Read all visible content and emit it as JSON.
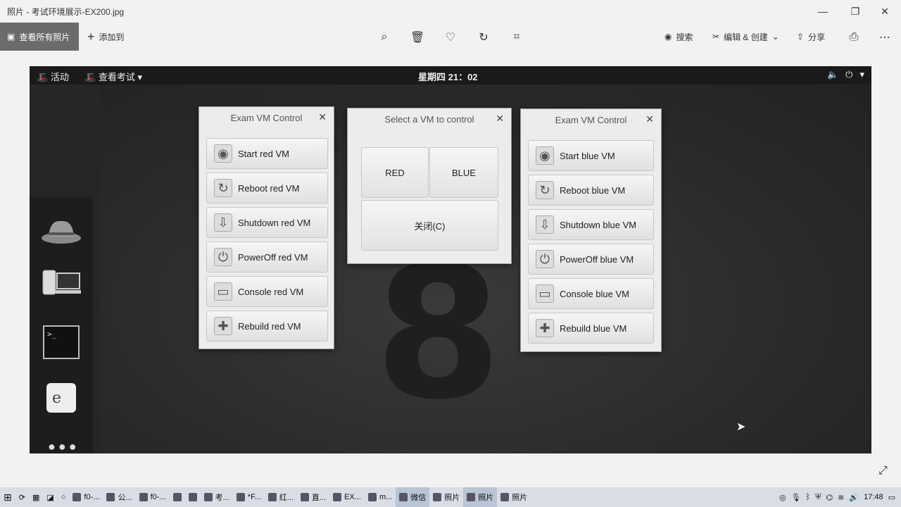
{
  "app": {
    "window_title": "照片 - 考试环境展示-EX200.jpg",
    "controls": {
      "minimize": "—",
      "maximize": "❐",
      "close": "✕"
    }
  },
  "toolbar": {
    "view_all": "查看所有照片",
    "add_to": "添加到",
    "search": "搜索",
    "edit_create": "编辑 & 创建",
    "share": "分享"
  },
  "gnome": {
    "activities": "活动",
    "app_menu": "查看考试",
    "clock": "星期四 21：02"
  },
  "red_dialog": {
    "title": "Exam VM Control",
    "buttons": [
      "Start  red  VM",
      "Reboot  red  VM",
      "Shutdown  red  VM",
      "PowerOff  red  VM",
      "Console  red  VM",
      "Rebuild  red  VM"
    ]
  },
  "select_dialog": {
    "title": "Select a VM to control",
    "red": "RED",
    "blue": "BLUE",
    "close": "关闭(C)"
  },
  "blue_dialog": {
    "title": "Exam VM Control",
    "buttons": [
      "Start  blue  VM",
      "Reboot  blue  VM",
      "Shutdown  blue  VM",
      "PowerOff  blue  VM",
      "Console  blue  VM",
      "Rebuild  blue  VM"
    ]
  },
  "taskbar": {
    "items": [
      "f0-...",
      "公...",
      "f0-...",
      "考...",
      "*F...",
      "红...",
      "直...",
      "EX...",
      "m...",
      "微信",
      "照片",
      "照片",
      "照片"
    ],
    "time": "17:48"
  }
}
